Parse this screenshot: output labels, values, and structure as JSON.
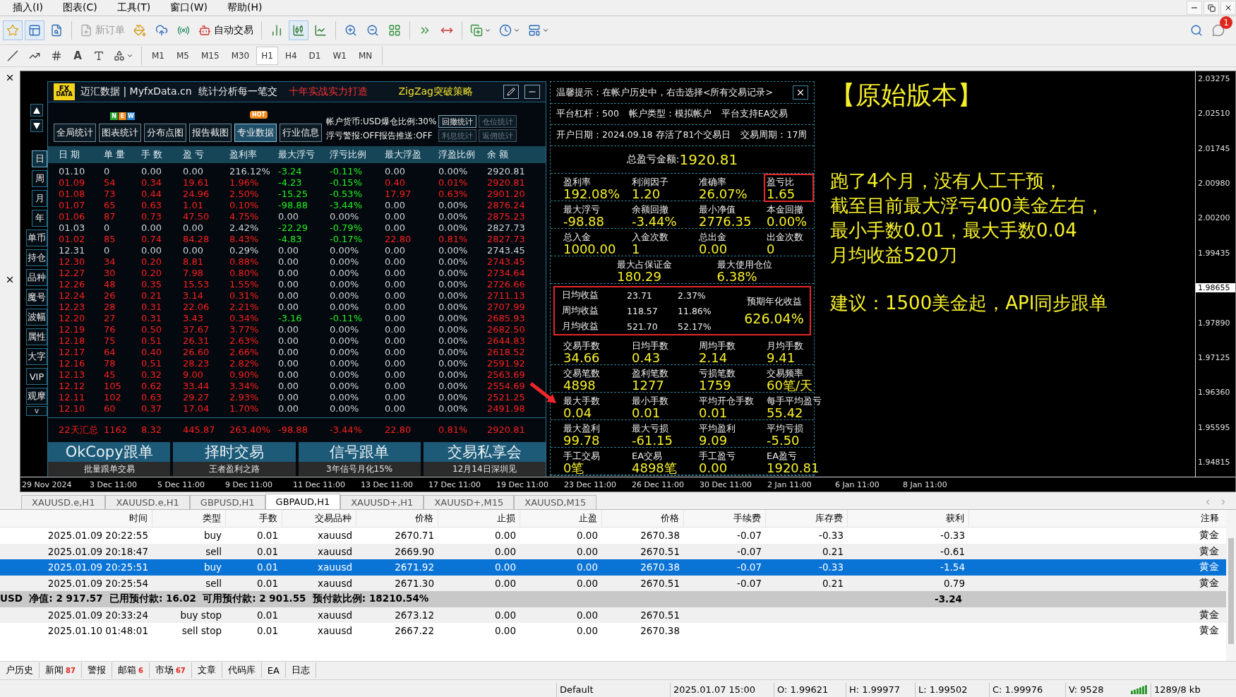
{
  "menu": [
    "插入(I)",
    "图表(C)",
    "工具(T)",
    "窗口(W)",
    "帮助(H)"
  ],
  "toolbar": {
    "new_order": {
      "label": "新订单",
      "disabled": true
    },
    "auto_trade": {
      "label": "自动交易",
      "disabled": false
    },
    "chart_types": [
      {
        "selected": false
      },
      {
        "selected": true
      },
      {
        "selected": false
      }
    ],
    "notification_count": "1"
  },
  "drawing_tools": {
    "text_tool": "A"
  },
  "timeframes": [
    {
      "label": "M1",
      "selected": false
    },
    {
      "label": "M5",
      "selected": false
    },
    {
      "label": "M15",
      "selected": false
    },
    {
      "label": "M30",
      "selected": false
    },
    {
      "label": "H1",
      "selected": true
    },
    {
      "label": "H4",
      "selected": false
    },
    {
      "label": "D1",
      "selected": false
    },
    {
      "label": "W1",
      "selected": false
    },
    {
      "label": "MN",
      "selected": false
    }
  ],
  "ea_panel": {
    "logo": [
      "FX",
      "DATA"
    ],
    "title": "迈汇数据 | MyfxData.cn  统计分析每一笔交",
    "slogan": "十年实战实力打造",
    "strategy": "ZigZag突破策略",
    "tabs": [
      {
        "label": "全局统计",
        "selected": false
      },
      {
        "label": "图表统计",
        "selected": false,
        "badge_letters": [
          "N",
          "E",
          "W"
        ]
      },
      {
        "label": "分布点图",
        "selected": false
      },
      {
        "label": "报告截图",
        "selected": false
      },
      {
        "label": "专业数据",
        "selected": true,
        "badge": "HOT"
      },
      {
        "label": "行业信息",
        "selected": false
      }
    ],
    "info_lines": [
      "帐户货币:USD爆仓比例:30%",
      "浮亏警报:OFF报告推送:OFF"
    ],
    "mini_buttons": [
      {
        "label": "回撤统计",
        "disabled": false
      },
      {
        "label": "仓位统计",
        "disabled": true
      },
      {
        "label": "利息统计",
        "disabled": true
      },
      {
        "label": "返佣统计",
        "disabled": true
      }
    ],
    "side_nav": [
      {
        "label": "日",
        "selected": true
      },
      {
        "label": "周",
        "selected": false
      },
      {
        "label": "月",
        "selected": false
      },
      {
        "label": "年",
        "selected": false
      },
      {
        "label": "单币",
        "selected": false
      },
      {
        "label": "持仓",
        "selected": false
      },
      {
        "label": "品种",
        "selected": false
      },
      {
        "label": "魔号",
        "selected": false
      },
      {
        "label": "波幅",
        "selected": false
      },
      {
        "label": "属性",
        "selected": false
      },
      {
        "label": "大字",
        "selected": false
      },
      {
        "label": "VIP",
        "selected": false
      },
      {
        "label": "观摩",
        "selected": false
      }
    ],
    "side_more": "v",
    "columns": [
      "日 期",
      "单 量",
      "手 数",
      "盈 亏",
      "盈利率",
      "最大浮亏",
      "浮亏比例",
      "最大浮盈",
      "浮盈比例",
      "余 额"
    ],
    "rows": [
      {
        "cells": [
          "01.10",
          "0",
          "0.00",
          "0.00",
          "216.12%",
          "-3.24",
          "-0.11%",
          "0.00",
          "0.00%",
          "2920.81"
        ],
        "profit": false,
        "floating_loss": true,
        "floating_profit": false
      },
      {
        "cells": [
          "01.09",
          "54",
          "0.34",
          "19.61",
          "1.96%",
          "-4.23",
          "-0.15%",
          "0.40",
          "0.01%",
          "2920.81"
        ],
        "profit": true,
        "floating_loss": true,
        "floating_profit": true
      },
      {
        "cells": [
          "01.08",
          "73",
          "0.44",
          "24.96",
          "2.50%",
          "-15.25",
          "-0.53%",
          "17.97",
          "0.63%",
          "2901.20"
        ],
        "profit": true,
        "floating_loss": true,
        "floating_profit": true
      },
      {
        "cells": [
          "01.07",
          "65",
          "0.63",
          "1.01",
          "0.10%",
          "-98.88",
          "-3.44%",
          "0.00",
          "0.00%",
          "2876.24"
        ],
        "profit": true,
        "floating_loss": true,
        "floating_profit": false
      },
      {
        "cells": [
          "01.06",
          "87",
          "0.73",
          "47.50",
          "4.75%",
          "0.00",
          "0.00%",
          "0.00",
          "0.00%",
          "2875.23"
        ],
        "profit": true,
        "floating_loss": false,
        "floating_profit": false
      },
      {
        "cells": [
          "01.03",
          "0",
          "0.00",
          "0.00",
          "2.42%",
          "-22.29",
          "-0.79%",
          "0.00",
          "0.00%",
          "2827.73"
        ],
        "profit": false,
        "floating_loss": true,
        "floating_profit": false
      },
      {
        "cells": [
          "01.02",
          "85",
          "0.74",
          "84.28",
          "8.43%",
          "-4.83",
          "-0.17%",
          "22.80",
          "0.81%",
          "2827.73"
        ],
        "profit": true,
        "floating_loss": true,
        "floating_profit": true
      },
      {
        "cells": [
          "12.31",
          "0",
          "0.00",
          "0.00",
          "0.29%",
          "0.00",
          "0.00%",
          "0.00",
          "0.00%",
          "2743.45"
        ],
        "profit": false,
        "floating_loss": false,
        "floating_profit": false
      },
      {
        "cells": [
          "12.30",
          "34",
          "0.20",
          "8.81",
          "0.88%",
          "0.00",
          "0.00%",
          "0.00",
          "0.00%",
          "2743.45"
        ],
        "profit": true,
        "floating_loss": false,
        "floating_profit": false
      },
      {
        "cells": [
          "12.27",
          "30",
          "0.20",
          "7.98",
          "0.80%",
          "0.00",
          "0.00%",
          "0.00",
          "0.00%",
          "2734.64"
        ],
        "profit": true,
        "floating_loss": false,
        "floating_profit": false
      },
      {
        "cells": [
          "12.26",
          "48",
          "0.35",
          "15.53",
          "1.55%",
          "0.00",
          "0.00%",
          "0.00",
          "0.00%",
          "2726.66"
        ],
        "profit": true,
        "floating_loss": false,
        "floating_profit": false
      },
      {
        "cells": [
          "12.24",
          "26",
          "0.21",
          "3.14",
          "0.31%",
          "0.00",
          "0.00%",
          "0.00",
          "0.00%",
          "2711.13"
        ],
        "profit": true,
        "floating_loss": false,
        "floating_profit": false
      },
      {
        "cells": [
          "12.23",
          "28",
          "0.31",
          "22.06",
          "2.21%",
          "0.00",
          "0.00%",
          "0.00",
          "0.00%",
          "2707.99"
        ],
        "profit": true,
        "floating_loss": false,
        "floating_profit": false
      },
      {
        "cells": [
          "12.20",
          "27",
          "0.31",
          "3.43",
          "0.34%",
          "-3.16",
          "-0.11%",
          "0.00",
          "0.00%",
          "2685.93"
        ],
        "profit": true,
        "floating_loss": true,
        "floating_profit": false
      },
      {
        "cells": [
          "12.19",
          "76",
          "0.50",
          "37.67",
          "3.77%",
          "0.00",
          "0.00%",
          "0.00",
          "0.00%",
          "2682.50"
        ],
        "profit": true,
        "floating_loss": false,
        "floating_profit": false
      },
      {
        "cells": [
          "12.18",
          "75",
          "0.51",
          "26.31",
          "2.63%",
          "0.00",
          "0.00%",
          "0.00",
          "0.00%",
          "2644.83"
        ],
        "profit": true,
        "floating_loss": false,
        "floating_profit": false
      },
      {
        "cells": [
          "12.17",
          "64",
          "0.40",
          "26.60",
          "2.66%",
          "0.00",
          "0.00%",
          "0.00",
          "0.00%",
          "2618.52"
        ],
        "profit": true,
        "floating_loss": false,
        "floating_profit": false
      },
      {
        "cells": [
          "12.16",
          "78",
          "0.51",
          "28.23",
          "2.82%",
          "0.00",
          "0.00%",
          "0.00",
          "0.00%",
          "2591.92"
        ],
        "profit": true,
        "floating_loss": false,
        "floating_profit": false
      },
      {
        "cells": [
          "12.13",
          "45",
          "0.32",
          "9.00",
          "0.90%",
          "0.00",
          "0.00%",
          "0.00",
          "0.00%",
          "2563.69"
        ],
        "profit": true,
        "floating_loss": false,
        "floating_profit": false
      },
      {
        "cells": [
          "12.12",
          "105",
          "0.62",
          "33.44",
          "3.34%",
          "0.00",
          "0.00%",
          "0.00",
          "0.00%",
          "2554.69"
        ],
        "profit": true,
        "floating_loss": false,
        "floating_profit": false
      },
      {
        "cells": [
          "12.11",
          "102",
          "0.63",
          "29.27",
          "2.93%",
          "0.00",
          "0.00%",
          "0.00",
          "0.00%",
          "2521.25"
        ],
        "profit": true,
        "floating_loss": false,
        "floating_profit": false
      },
      {
        "cells": [
          "12.10",
          "60",
          "0.37",
          "17.04",
          "1.70%",
          "0.00",
          "0.00%",
          "0.00",
          "0.00%",
          "2491.98"
        ],
        "profit": true,
        "floating_loss": false,
        "floating_profit": false
      }
    ],
    "summary": [
      "22天汇总",
      "1162",
      "8.32",
      "445.87",
      "263.40%",
      "-98.88",
      "-3.44%",
      "22.80",
      "0.81%",
      "2920.81"
    ],
    "banners": [
      {
        "title": "OkCopy跟单",
        "subtitle": "批量跟单交易"
      },
      {
        "title": "择时交易",
        "subtitle": "王者盈利之路"
      },
      {
        "title": "信号跟单",
        "subtitle": "3年信号月化15%"
      },
      {
        "title": "交易私享会",
        "subtitle": "12月14日深圳见"
      }
    ]
  },
  "stats_panel": {
    "tip": "温馨提示：在帐户历史中，右击选择<所有交易记录>",
    "info_rows": [
      [
        "平台杠杆：500",
        "帐户类型：模拟帐户",
        "平台支持EA交易"
      ],
      [
        "开户日期：2024.09.18 存活了81个交易日",
        "交易周期：17周"
      ]
    ],
    "total": {
      "label": "总盈亏金额:",
      "value": "1920.81"
    },
    "metric_rows_top": [
      [
        {
          "label": "盈利率",
          "value": "192.08%",
          "boxed": false
        },
        {
          "label": "利润因子",
          "value": "1.20",
          "boxed": false
        },
        {
          "label": "准确率",
          "value": "26.07%",
          "boxed": false
        },
        {
          "label": "盈亏比",
          "value": "1.65",
          "boxed": true
        }
      ],
      [
        {
          "label": "最大浮亏",
          "value": "-98.88",
          "boxed": false
        },
        {
          "label": "余额回撤",
          "value": "-3.44%",
          "boxed": false
        },
        {
          "label": "最小净值",
          "value": "2776.35",
          "boxed": false
        },
        {
          "label": "本金回撤",
          "value": "0.00%",
          "boxed": false
        }
      ],
      [
        {
          "label": "总入金",
          "value": "1000.00",
          "boxed": false
        },
        {
          "label": "入金次数",
          "value": "1",
          "boxed": false
        },
        {
          "label": "总出金",
          "value": "0.00",
          "boxed": false
        },
        {
          "label": "出金次数",
          "value": "0",
          "boxed": false
        }
      ],
      [
        {
          "label": "最大占保证金",
          "value": "180.29",
          "boxed": false
        },
        {
          "label": "最大使用仓位",
          "value": "6.38%",
          "boxed": false
        }
      ]
    ],
    "averages": {
      "rows": [
        [
          "日均收益",
          "23.71",
          "2.37%"
        ],
        [
          "周均收益",
          "118.57",
          "11.86%"
        ],
        [
          "月均收益",
          "521.70",
          "52.17%"
        ]
      ],
      "annual_label": "预期年化收益",
      "annual_value": "626.04%"
    },
    "metric_rows_bottom": [
      [
        {
          "label": "交易手数",
          "value": "34.66",
          "boxed": false
        },
        {
          "label": "日均手数",
          "value": "0.43",
          "boxed": false
        },
        {
          "label": "周均手数",
          "value": "2.14",
          "boxed": false
        },
        {
          "label": "月均手数",
          "value": "9.41",
          "boxed": false
        }
      ],
      [
        {
          "label": "交易笔数",
          "value": "4898",
          "boxed": false
        },
        {
          "label": "盈利笔数",
          "value": "1277",
          "boxed": false
        },
        {
          "label": "亏损笔数",
          "value": "1759",
          "boxed": false
        },
        {
          "label": "交易频率",
          "value": "60笔/天",
          "boxed": false
        }
      ],
      [
        {
          "label": "最大手数",
          "value": "0.04",
          "boxed": false
        },
        {
          "label": "最小手数",
          "value": "0.01",
          "boxed": false
        },
        {
          "label": "平均开仓手数",
          "value": "0.01",
          "boxed": false
        },
        {
          "label": "每手平均盈亏",
          "value": "55.42",
          "boxed": false
        }
      ],
      [
        {
          "label": "最大盈利",
          "value": "99.78",
          "boxed": false
        },
        {
          "label": "最大亏损",
          "value": "-61.15",
          "boxed": false
        },
        {
          "label": "平均盈利",
          "value": "9.09",
          "boxed": false
        },
        {
          "label": "平均亏损",
          "value": "-5.50",
          "boxed": false
        }
      ],
      [
        {
          "label": "手工交易",
          "value": "0笔",
          "boxed": false
        },
        {
          "label": "EA交易",
          "value": "4898笔",
          "boxed": false
        },
        {
          "label": "手工盈亏",
          "value": "0.00",
          "boxed": false
        },
        {
          "label": "EA盈亏",
          "value": "1920.81",
          "boxed": false
        }
      ]
    ]
  },
  "notes": {
    "title": "【原始版本】",
    "lines": [
      "跑了4个月，没有人工干预，",
      "截至目前最大浮亏400美金左右，",
      "最小手数0.01，最大手数0.04",
      "月均收益520刀"
    ],
    "advice": "建议：1500美金起，API同步跟单"
  },
  "price_axis": [
    {
      "text": "2.03275",
      "current": false
    },
    {
      "text": "2.02510",
      "current": false
    },
    {
      "text": "2.01745",
      "current": false
    },
    {
      "text": "2.00980",
      "current": false
    },
    {
      "text": "2.00200",
      "current": false
    },
    {
      "text": "1.99435",
      "current": false
    },
    {
      "text": "1.98655",
      "current": true
    },
    {
      "text": "1.97890",
      "current": false
    },
    {
      "text": "1.97125",
      "current": false
    },
    {
      "text": "1.96360",
      "current": false
    },
    {
      "text": "1.95595",
      "current": false
    },
    {
      "text": "1.94815",
      "current": false
    }
  ],
  "time_axis": [
    "29 Nov 2024",
    "3 Dec 11:00",
    "5 Dec 11:00",
    "9 Dec 11:00",
    "11 Dec 11:00",
    "13 Dec 11:00",
    "17 Dec 11:00",
    "19 Dec 11:00",
    "23 Dec 11:00",
    "26 Dec 11:00",
    "30 Dec 11:00",
    "2 Jan 11:00",
    "6 Jan 11:00",
    "8 Jan 11:00"
  ],
  "chart_tabs": [
    {
      "label": "XAUUSD.e,H1",
      "selected": false
    },
    {
      "label": "XAUUSD.e,H1",
      "selected": false
    },
    {
      "label": "GBPUSD,H1",
      "selected": false
    },
    {
      "label": "GBPAUD,H1",
      "selected": true
    },
    {
      "label": "XAUUSD+,H1",
      "selected": false
    },
    {
      "label": "XAUUSD+,M15",
      "selected": false
    },
    {
      "label": "XAUUSD,M15",
      "selected": false
    }
  ],
  "terminal": {
    "columns": [
      "时间",
      "类型",
      "手数",
      "交易品种",
      "价格",
      "止损",
      "止盈",
      "价格",
      "手续费",
      "库存费",
      "获利",
      "注释"
    ],
    "rows": [
      {
        "values": [
          "2025.01.09 20:22:55",
          "buy",
          "0.01",
          "xauusd",
          "2670.71",
          "0.00",
          "0.00",
          "2670.38",
          "-0.07",
          "-0.33",
          "-0.33"
        ],
        "note": "黄金",
        "selected": false
      },
      {
        "values": [
          "2025.01.09 20:18:47",
          "sell",
          "0.01",
          "xauusd",
          "2669.90",
          "0.00",
          "0.00",
          "2670.51",
          "-0.07",
          "0.21",
          "-0.61"
        ],
        "note": "黄金",
        "selected": false
      },
      {
        "values": [
          "2025.01.09 20:25:51",
          "buy",
          "0.01",
          "xauusd",
          "2671.92",
          "0.00",
          "0.00",
          "2670.38",
          "-0.07",
          "-0.33",
          "-1.54"
        ],
        "note": "黄金",
        "selected": true
      },
      {
        "values": [
          "2025.01.09 20:25:54",
          "sell",
          "0.01",
          "xauusd",
          "2671.30",
          "0.00",
          "0.00",
          "2670.51",
          "-0.07",
          "0.21",
          "0.79"
        ],
        "note": "黄金",
        "selected": false
      }
    ],
    "summary": {
      "text": "USD  净值: 2 917.57  已用预付款: 16.02  可用预付款: 2 901.55  预付款比例: 18210.54%",
      "profit": "-3.24"
    },
    "pending_rows": [
      {
        "values": [
          "2025.01.09 20:33:24",
          "buy stop",
          "0.01",
          "xauusd",
          "2673.12",
          "0.00",
          "0.00",
          "2670.51"
        ],
        "note": "黄金",
        "selected": false
      },
      {
        "values": [
          "2025.01.10 01:48:01",
          "sell stop",
          "0.01",
          "xauusd",
          "2667.22",
          "0.00",
          "0.00",
          "2670.38"
        ],
        "note": "黄金",
        "selected": false
      }
    ]
  },
  "bottom_tabs": [
    {
      "label": "户历史"
    },
    {
      "label": "新闻",
      "count": "87"
    },
    {
      "label": "警报"
    },
    {
      "label": "邮箱",
      "count": "6"
    },
    {
      "label": "市场",
      "count": "67"
    },
    {
      "label": "文章"
    },
    {
      "label": "代码库"
    },
    {
      "label": "EA"
    },
    {
      "label": "日志"
    }
  ],
  "status_bar": {
    "profile": "Default",
    "time": "2025.01.07 15:00",
    "open": "O: 1.99621",
    "high": "H: 1.99977",
    "low": "L: 1.99502",
    "close": "C: 1.99976",
    "volume": "V: 9528",
    "traffic": "1289/8 kb"
  }
}
